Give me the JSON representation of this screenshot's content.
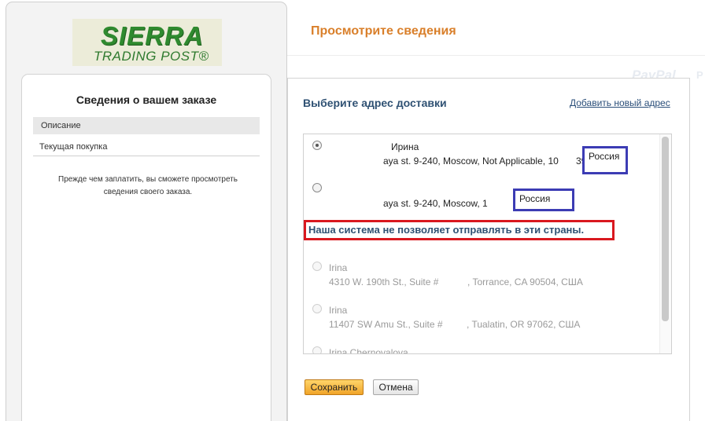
{
  "logo": {
    "line1": "SIERRA",
    "line2": "TRADING POST®"
  },
  "order_panel": {
    "title": "Сведения о вашем заказе",
    "description_label": "Описание",
    "current_purchase_label": "Текущая покупка",
    "pre_payment_text": "Прежде чем заплатить, вы сможете просмотреть сведения своего заказа."
  },
  "header": {
    "title": "Просмотрите сведения",
    "watermark_brand": "PayPal",
    "watermark_fragment": "P"
  },
  "shipping": {
    "title": "Выберите адрес доставки",
    "add_address_link": "Добавить новый адрес",
    "addresses": [
      {
        "name": "Ирина",
        "street": "aya st. 9-240, Moscow, Not Applicable, 10",
        "street_tail": "39",
        "country": "Россия",
        "selected": true,
        "enabled": true
      },
      {
        "name": "",
        "street": "aya st. 9-240, Moscow, 1",
        "street_tail": "",
        "country": "Россия",
        "selected": false,
        "enabled": true
      },
      {
        "name": "Irina",
        "street": "4310 W. 190th St., Suite #",
        "street_tail": ", Torrance, CA 90504, США",
        "selected": false,
        "enabled": false
      },
      {
        "name": "Irina",
        "street": "11407 SW Amu St., Suite #",
        "street_tail": ", Tualatin, OR 97062, США",
        "selected": false,
        "enabled": false
      },
      {
        "name": "Irina Chernovalova",
        "selected": false,
        "enabled": false
      }
    ],
    "warning": "Наша система не позволяет отправлять в эти страны."
  },
  "buttons": {
    "save": "Сохранить",
    "cancel": "Отмена"
  },
  "colors": {
    "accent_orange": "#d97f2a",
    "heading_blue": "#2f5173",
    "highlight_blue": "#3c3cb4",
    "warning_red": "#d9181f",
    "logo_green": "#2f8a2f"
  }
}
